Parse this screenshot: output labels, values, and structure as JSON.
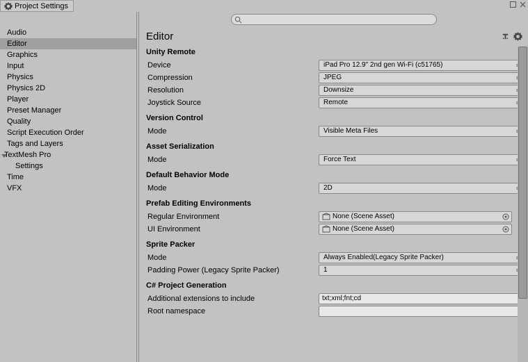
{
  "window": {
    "title": "Project Settings"
  },
  "sidebar": {
    "items": [
      {
        "label": "Audio"
      },
      {
        "label": "Editor",
        "selected": true
      },
      {
        "label": "Graphics"
      },
      {
        "label": "Input"
      },
      {
        "label": "Physics"
      },
      {
        "label": "Physics 2D"
      },
      {
        "label": "Player"
      },
      {
        "label": "Preset Manager"
      },
      {
        "label": "Quality"
      },
      {
        "label": "Script Execution Order"
      },
      {
        "label": "Tags and Layers"
      },
      {
        "label": "TextMesh Pro",
        "expanded": true,
        "children": [
          {
            "label": "Settings"
          }
        ]
      },
      {
        "label": "Time"
      },
      {
        "label": "VFX"
      }
    ]
  },
  "search": {
    "placeholder": ""
  },
  "inspector": {
    "title": "Editor",
    "sections": {
      "unityRemote": {
        "heading": "Unity Remote",
        "device": {
          "label": "Device",
          "value": "iPad Pro 12.9\" 2nd gen Wi-Fi (c51765)"
        },
        "compression": {
          "label": "Compression",
          "value": "JPEG"
        },
        "resolution": {
          "label": "Resolution",
          "value": "Downsize"
        },
        "joystick": {
          "label": "Joystick Source",
          "value": "Remote"
        }
      },
      "versionControl": {
        "heading": "Version Control",
        "mode": {
          "label": "Mode",
          "value": "Visible Meta Files"
        }
      },
      "assetSerialization": {
        "heading": "Asset Serialization",
        "mode": {
          "label": "Mode",
          "value": "Force Text"
        }
      },
      "defaultBehavior": {
        "heading": "Default Behavior Mode",
        "mode": {
          "label": "Mode",
          "value": "2D"
        }
      },
      "prefabEnv": {
        "heading": "Prefab Editing Environments",
        "regular": {
          "label": "Regular Environment",
          "value": "None (Scene Asset)"
        },
        "ui": {
          "label": "UI Environment",
          "value": "None (Scene Asset)"
        }
      },
      "spritePacker": {
        "heading": "Sprite Packer",
        "mode": {
          "label": "Mode",
          "value": "Always Enabled(Legacy Sprite Packer)"
        },
        "padding": {
          "label": "Padding Power (Legacy Sprite Packer)",
          "value": "1"
        }
      },
      "csharpGen": {
        "heading": "C# Project Generation",
        "extensions": {
          "label": "Additional extensions to include",
          "value": "txt;xml;fnt;cd"
        },
        "rootns": {
          "label": "Root namespace",
          "value": ""
        }
      }
    }
  }
}
